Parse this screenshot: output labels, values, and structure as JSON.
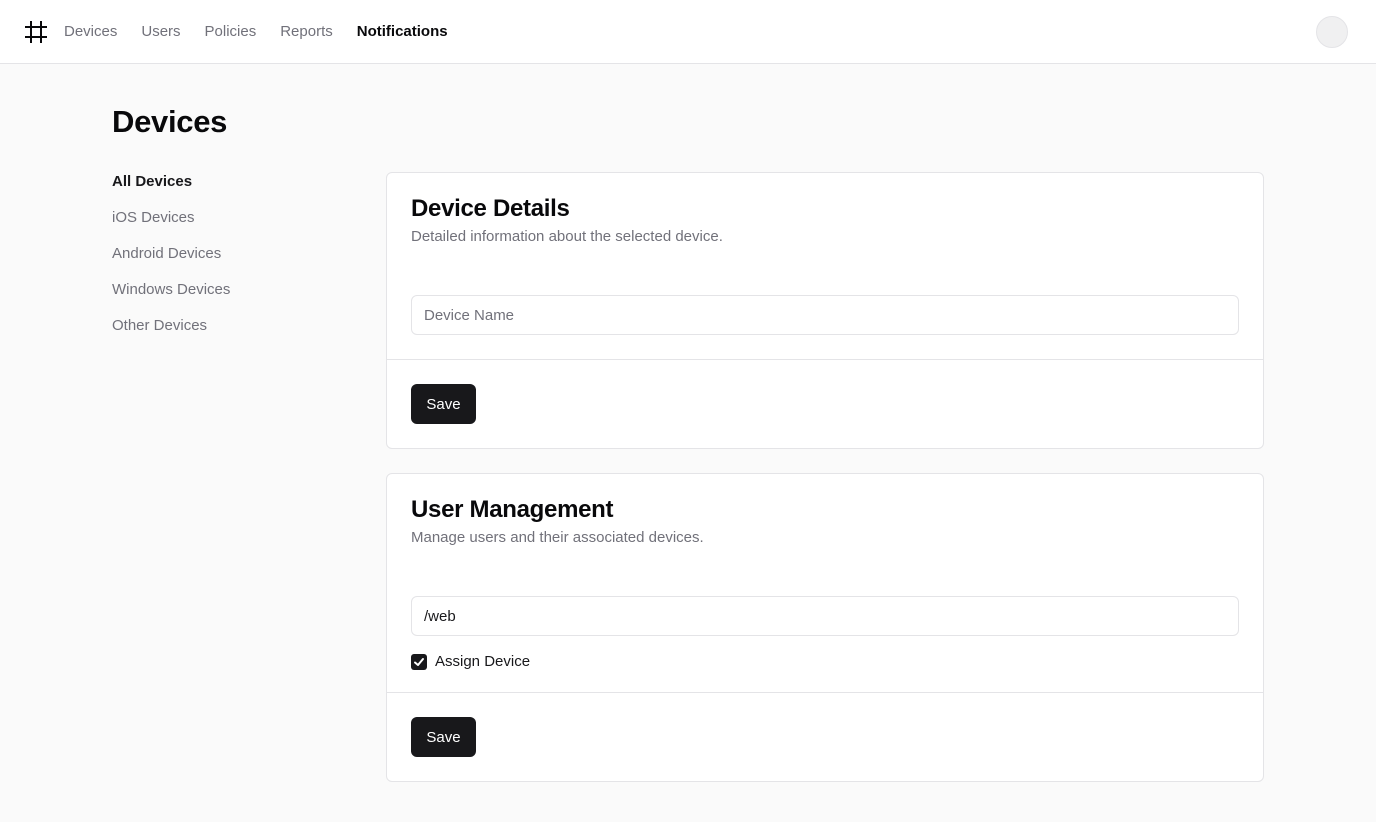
{
  "header": {
    "logo_icon": "hash-icon",
    "nav": [
      {
        "label": "Devices",
        "active": false
      },
      {
        "label": "Users",
        "active": false
      },
      {
        "label": "Policies",
        "active": false
      },
      {
        "label": "Reports",
        "active": false
      },
      {
        "label": "Notifications",
        "active": true
      }
    ],
    "avatar_icon": "avatar-icon"
  },
  "page": {
    "title": "Devices"
  },
  "sidebar": {
    "items": [
      {
        "label": "All Devices",
        "active": true
      },
      {
        "label": "iOS Devices",
        "active": false
      },
      {
        "label": "Android Devices",
        "active": false
      },
      {
        "label": "Windows Devices",
        "active": false
      },
      {
        "label": "Other Devices",
        "active": false
      }
    ]
  },
  "device_details": {
    "title": "Device Details",
    "description": "Detailed information about the selected device.",
    "name_input": {
      "value": "",
      "placeholder": "Device Name"
    },
    "save_label": "Save"
  },
  "user_management": {
    "title": "User Management",
    "description": "Manage users and their associated devices.",
    "path_input": {
      "value": "/web",
      "placeholder": ""
    },
    "assign_checkbox": {
      "label": "Assign Device",
      "checked": true,
      "icon": "check-icon"
    },
    "save_label": "Save"
  },
  "colors": {
    "primary": "#18181b",
    "muted_text": "#71717a",
    "border": "#e4e4e7",
    "background": "#fafafa"
  }
}
